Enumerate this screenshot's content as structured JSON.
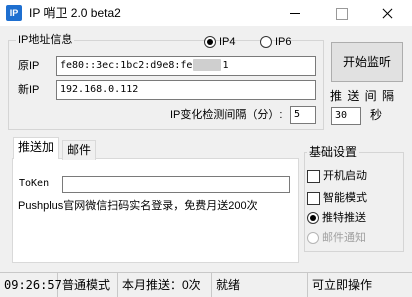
{
  "window": {
    "icon_text": "IP",
    "title": "IP 哨卫 2.0 beta2"
  },
  "ip_group": {
    "title": "IP地址信息",
    "ipv4_label": "IP4",
    "ipv6_label": "IP6",
    "original_ip_label": "原IP",
    "original_ip_value_prefix": "fe80::3ec:1bc2:d9e8:fe",
    "original_ip_value_suffix": "1",
    "new_ip_label": "新IP",
    "new_ip_value": "192.168.0.112",
    "interval_label": "IP变化检测间隔（分）:",
    "interval_value": "5"
  },
  "start_button_label": "开始监听",
  "push_interval": {
    "label": "推 送 间 隔",
    "value": "30",
    "unit": "秒"
  },
  "tabs": {
    "push": "推送加",
    "mail": "邮件"
  },
  "push_panel": {
    "token_label": "ToKen",
    "token_value": "",
    "info_text": "Pushplus官网微信扫码实名登录，免费月送200次"
  },
  "settings": {
    "title": "基础设置",
    "autostart": "开机启动",
    "smart_mode": "智能模式",
    "push_option": "推特推送",
    "mail_option": "邮件通知"
  },
  "status": {
    "time": "09:26:57",
    "mode": "普通模式",
    "monthly_push": "本月推送：0次",
    "state": "就绪",
    "action": "可立即操作"
  }
}
